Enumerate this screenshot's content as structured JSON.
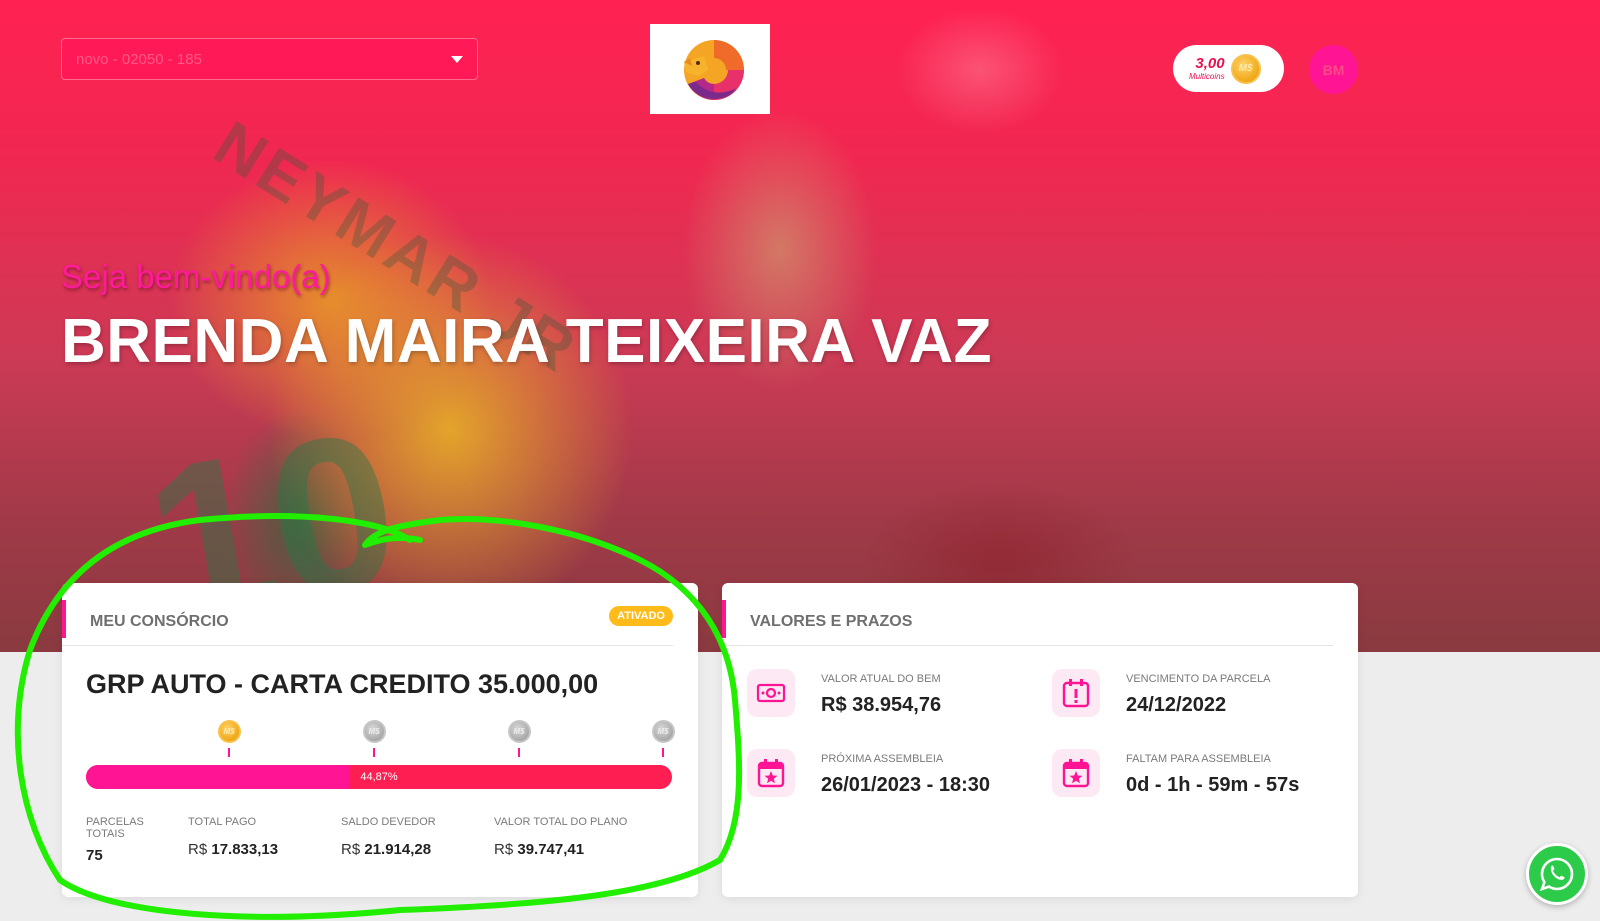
{
  "header": {
    "selector_value": "novo - 02050 - 185",
    "multicoins_amount": "3,00",
    "multicoins_label": "Multicoins",
    "coin_symbol": "M$",
    "avatar_initials": "BM"
  },
  "hero": {
    "welcome": "Seja bem-vindo(a)",
    "user_name": "BRENDA MAIRA TEIXEIRA VAZ"
  },
  "consorcio_card": {
    "title": "MEU CONSÓRCIO",
    "status_badge": "ATIVADO",
    "plan_name": "GRP AUTO - CARTA CREDITO 35.000,00",
    "progress_label": "44,87%",
    "progress_fraction": 0.4487,
    "milestones": [
      {
        "symbol": "M$",
        "state": "gold"
      },
      {
        "symbol": "M$",
        "state": "grey"
      },
      {
        "symbol": "M$",
        "state": "grey"
      },
      {
        "symbol": "M$",
        "state": "grey"
      }
    ],
    "stats": {
      "parcelas_label": "PARCELAS TOTAIS",
      "parcelas_value": "75",
      "total_pago_label": "TOTAL PAGO",
      "total_pago_currency": "R$",
      "total_pago_value": "17.833,13",
      "saldo_label": "SALDO DEVEDOR",
      "saldo_currency": "R$",
      "saldo_value": "21.914,28",
      "valor_total_label": "VALOR TOTAL DO PLANO",
      "valor_total_currency": "R$",
      "valor_total_value": "39.747,41"
    }
  },
  "valores_card": {
    "title": "VALORES E PRAZOS",
    "items": [
      {
        "icon": "money-icon",
        "label": "VALOR ATUAL DO BEM",
        "value": "R$ 38.954,76"
      },
      {
        "icon": "calendar-alert-icon",
        "label": "VENCIMENTO DA PARCELA",
        "value": "24/12/2022"
      },
      {
        "icon": "calendar-star-icon",
        "label": "PRÓXIMA ASSEMBLEIA",
        "value": "26/01/2023 - 18:30"
      },
      {
        "icon": "calendar-star-icon",
        "label": "FALTAM PARA ASSEMBLEIA",
        "value": "0d - 1h - 59m - 57s"
      }
    ]
  },
  "colors": {
    "brand_pink": "#ff1493",
    "brand_red": "#ff1e52",
    "badge_yellow": "#ffbb1a",
    "whatsapp_green": "#2ccb4a",
    "annotation_green": "#22ee00"
  }
}
